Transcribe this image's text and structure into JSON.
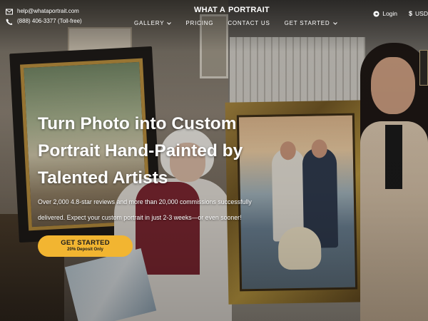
{
  "contact": {
    "email": "help@whataportrait.com",
    "phone": "(888) 406-3377 (Toll-free)"
  },
  "logo": {
    "text_left": "WHAT A",
    "text_right": "PORTRAIT"
  },
  "nav": [
    {
      "label": "GALLERY",
      "has_dropdown": true
    },
    {
      "label": "PRICING",
      "has_dropdown": false
    },
    {
      "label": "CONTACT US",
      "has_dropdown": false
    },
    {
      "label": "GET STARTED",
      "has_dropdown": true
    }
  ],
  "tools": {
    "login_label": "Login",
    "currency_label": "USD"
  },
  "hero": {
    "title": "Turn Photo into Custom Portrait Hand-Painted by Talented Artists",
    "subtitle": "Over 2,000 4.8-star reviews and more than 20,000 commissions successfully delivered. Expect your custom portrait in just 2-3 weeks—or even sooner!",
    "cta_label": "GET STARTED",
    "cta_note": "20% Deposit Only"
  },
  "colors": {
    "accent": "#f2b531",
    "text": "#ffffff"
  },
  "icons": {
    "email": "envelope-icon",
    "phone": "phone-icon",
    "login": "login-icon",
    "currency": "dollar-icon",
    "dropdown": "chevron-down-icon"
  }
}
